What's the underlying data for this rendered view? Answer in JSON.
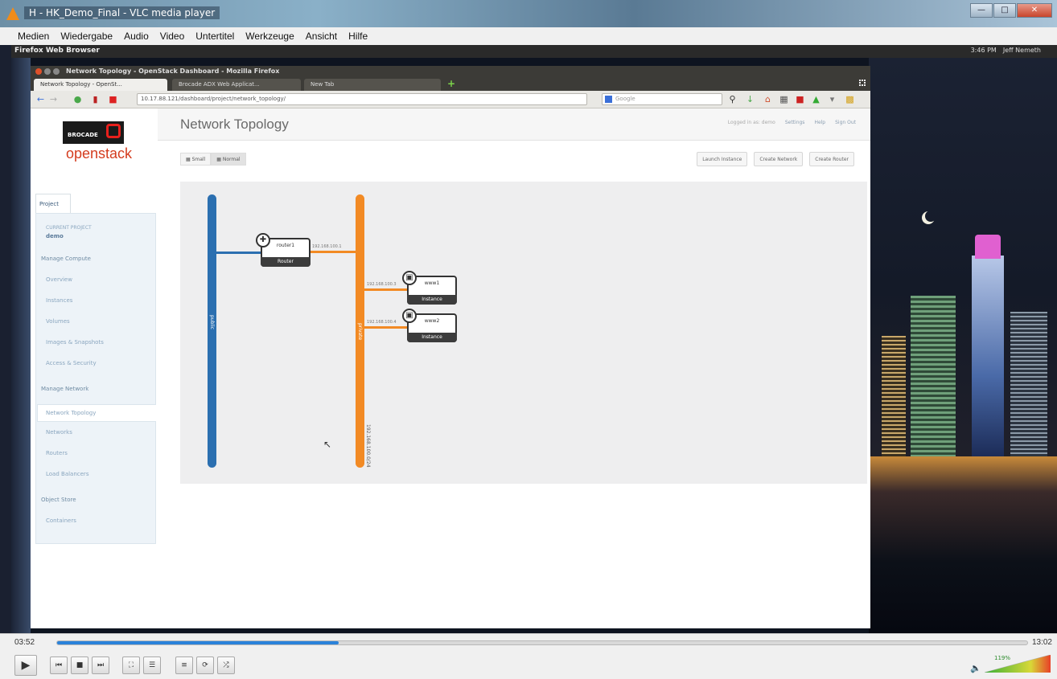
{
  "vlc": {
    "title": "H - HK_Demo_Final - VLC media player",
    "menu": [
      "Medien",
      "Wiedergabe",
      "Audio",
      "Video",
      "Untertitel",
      "Werkzeuge",
      "Ansicht",
      "Hilfe"
    ],
    "time_current": "03:52",
    "time_total": "13:02",
    "progress": 0.29,
    "volume_percent": "119%",
    "controls": [
      "play",
      "previous",
      "stop",
      "next",
      "fullscreen",
      "extended-settings",
      "playlist",
      "loop",
      "random"
    ]
  },
  "desktop": {
    "panel_title": "Firefox Web Browser",
    "status_time": "3:46 PM",
    "status_user": "Jeff Nemeth"
  },
  "firefox": {
    "title": "Network Topology - OpenStack Dashboard - Mozilla Firefox",
    "tabs": [
      {
        "label": "Network Topology - OpenSt...",
        "active": true
      },
      {
        "label": "Brocade ADX Web Applicat...",
        "active": false
      },
      {
        "label": "New Tab",
        "active": false
      }
    ],
    "url": "10.17.88.121/dashboard/project/network_topology/",
    "search_placeholder": "Google"
  },
  "openstack": {
    "brand_top": "BROCADE",
    "brand_bottom": "openstack",
    "project_tab": "Project",
    "current_project_label": "CURRENT PROJECT",
    "current_project": "demo",
    "sections": [
      {
        "title": "Manage Compute",
        "items": [
          "Overview",
          "Instances",
          "Volumes",
          "Images & Snapshots",
          "Access & Security"
        ]
      },
      {
        "title": "Manage Network",
        "items": [
          "Network Topology",
          "Networks",
          "Routers",
          "Load Balancers"
        ]
      },
      {
        "title": "Object Store",
        "items": [
          "Containers"
        ]
      }
    ],
    "page_title": "Network Topology",
    "header_links": [
      "Logged in as: demo",
      "Settings",
      "Help",
      "Sign Out"
    ],
    "view_toggle": [
      "Small",
      "Normal"
    ],
    "actions": [
      "Launch Instance",
      "Create Network",
      "Create Router"
    ],
    "topology": {
      "networks": [
        {
          "name": "public",
          "color": "#2b6fb0",
          "cidr": ""
        },
        {
          "name": "private",
          "color": "#f28a24",
          "cidr": "192.168.100.0/24"
        }
      ],
      "router": {
        "name": "router1",
        "type": "Router",
        "ip": "192.168.100.1"
      },
      "instances": [
        {
          "name": "www1",
          "type": "Instance",
          "ip": "192.168.100.3"
        },
        {
          "name": "www2",
          "type": "Instance",
          "ip": "192.168.100.4"
        }
      ]
    }
  }
}
